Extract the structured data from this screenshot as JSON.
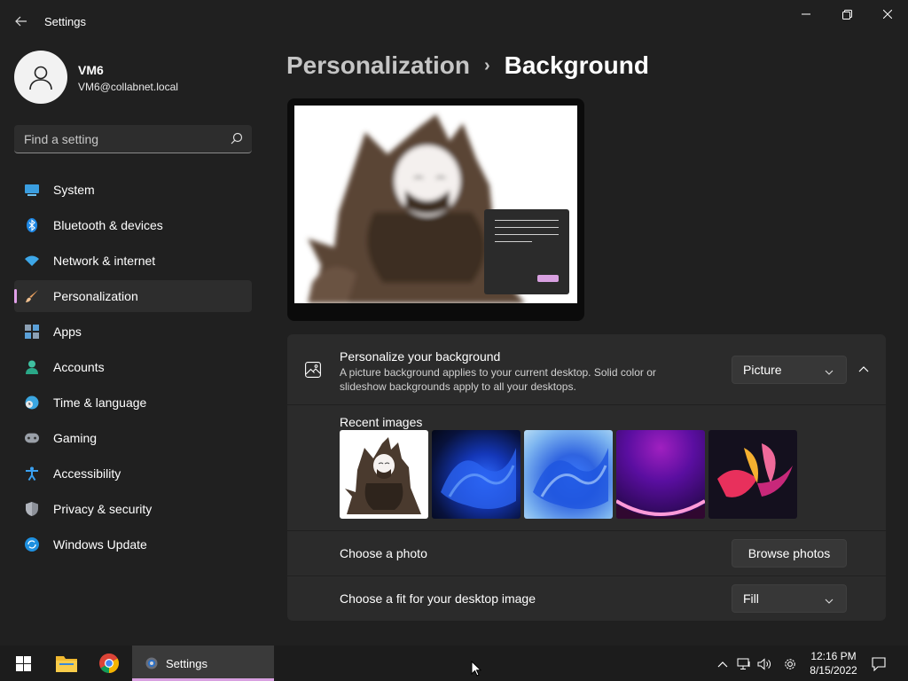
{
  "window": {
    "title": "Settings"
  },
  "user": {
    "name": "VM6",
    "email": "VM6@collabnet.local"
  },
  "search": {
    "placeholder": "Find a setting"
  },
  "sidebar": {
    "items": [
      {
        "label": "System",
        "icon": "monitor-icon"
      },
      {
        "label": "Bluetooth & devices",
        "icon": "bluetooth-icon"
      },
      {
        "label": "Network & internet",
        "icon": "wifi-icon"
      },
      {
        "label": "Personalization",
        "icon": "paintbrush-icon",
        "active": true
      },
      {
        "label": "Apps",
        "icon": "apps-icon"
      },
      {
        "label": "Accounts",
        "icon": "person-icon"
      },
      {
        "label": "Time & language",
        "icon": "clock-globe-icon"
      },
      {
        "label": "Gaming",
        "icon": "gamepad-icon"
      },
      {
        "label": "Accessibility",
        "icon": "accessibility-icon"
      },
      {
        "label": "Privacy & security",
        "icon": "shield-icon"
      },
      {
        "label": "Windows Update",
        "icon": "update-icon"
      }
    ]
  },
  "breadcrumb": {
    "parent": "Personalization",
    "separator": "›",
    "current": "Background"
  },
  "background_section": {
    "title": "Personalize your background",
    "description": "A picture background applies to your current desktop. Solid color or slideshow backgrounds apply to all your desktops.",
    "type_value": "Picture"
  },
  "recent_images": {
    "label": "Recent images",
    "items": [
      "character-art",
      "bloom-blue-dark",
      "bloom-blue-light",
      "glow-purple",
      "flower-pink"
    ]
  },
  "choose_photo": {
    "label": "Choose a photo",
    "button_label": "Browse photos"
  },
  "fit": {
    "label": "Choose a fit for your desktop image",
    "value": "Fill"
  },
  "taskbar": {
    "active_app_label": "Settings",
    "time": "12:16 PM",
    "date": "8/15/2022"
  },
  "colors": {
    "accent": "#d8a0e0",
    "background": "#202020",
    "card": "#2b2b2b"
  }
}
